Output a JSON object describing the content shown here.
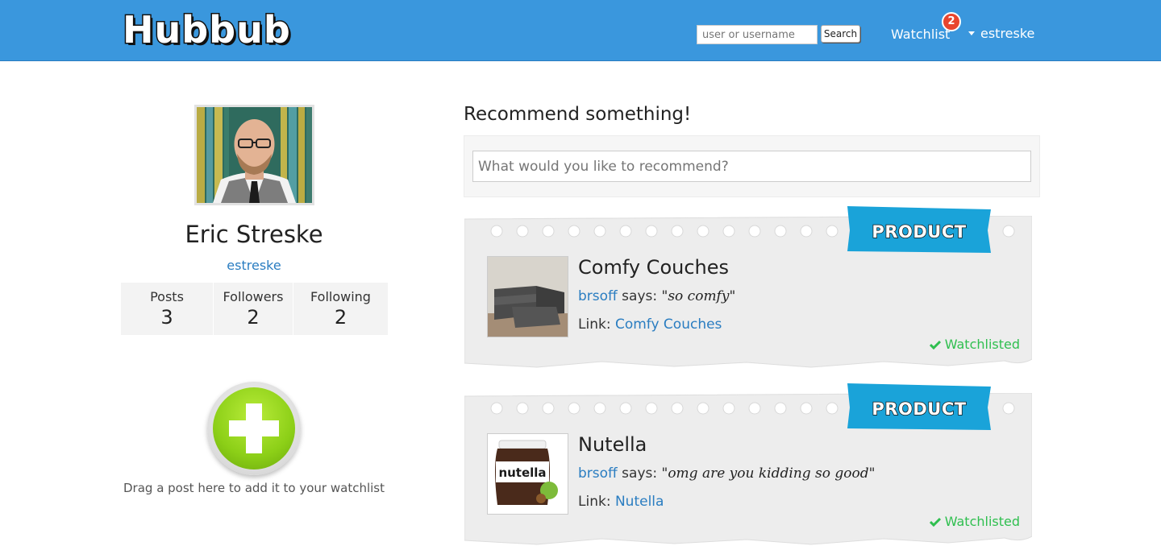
{
  "header": {
    "logo": "Hubbub",
    "search_placeholder": "user or username",
    "search_button": "Search",
    "watchlist_label": "Watchlist",
    "watchlist_count": "2",
    "username": "estreske"
  },
  "profile": {
    "name": "Eric Streske",
    "handle": "estreske",
    "stats": [
      {
        "label": "Posts",
        "value": "3"
      },
      {
        "label": "Followers",
        "value": "2"
      },
      {
        "label": "Following",
        "value": "2"
      }
    ],
    "drag_hint": "Drag a post here to add it to your watchlist"
  },
  "recommend": {
    "title": "Recommend something!",
    "placeholder": "What would you like to recommend?"
  },
  "posts": [
    {
      "category": "PRODUCT",
      "title": "Comfy Couches",
      "author": "brsoff",
      "says_word": "says:",
      "quote": "\"so comfy\"",
      "link_prefix": "Link:",
      "link_text": "Comfy Couches",
      "status": "Watchlisted"
    },
    {
      "category": "PRODUCT",
      "title": "Nutella",
      "author": "brsoff",
      "says_word": "says:",
      "quote": "\"omg are you kidding so good\"",
      "link_prefix": "Link:",
      "link_text": "Nutella",
      "status": "Watchlisted",
      "thumb_label": "nutella"
    }
  ],
  "colors": {
    "navbar": "#3a97dd",
    "link": "#2a7dc1",
    "ribbon": "#1aa3d9",
    "watchlisted": "#2fbf4f",
    "badge": "#e8452e",
    "add_button": "#8ccf17"
  }
}
